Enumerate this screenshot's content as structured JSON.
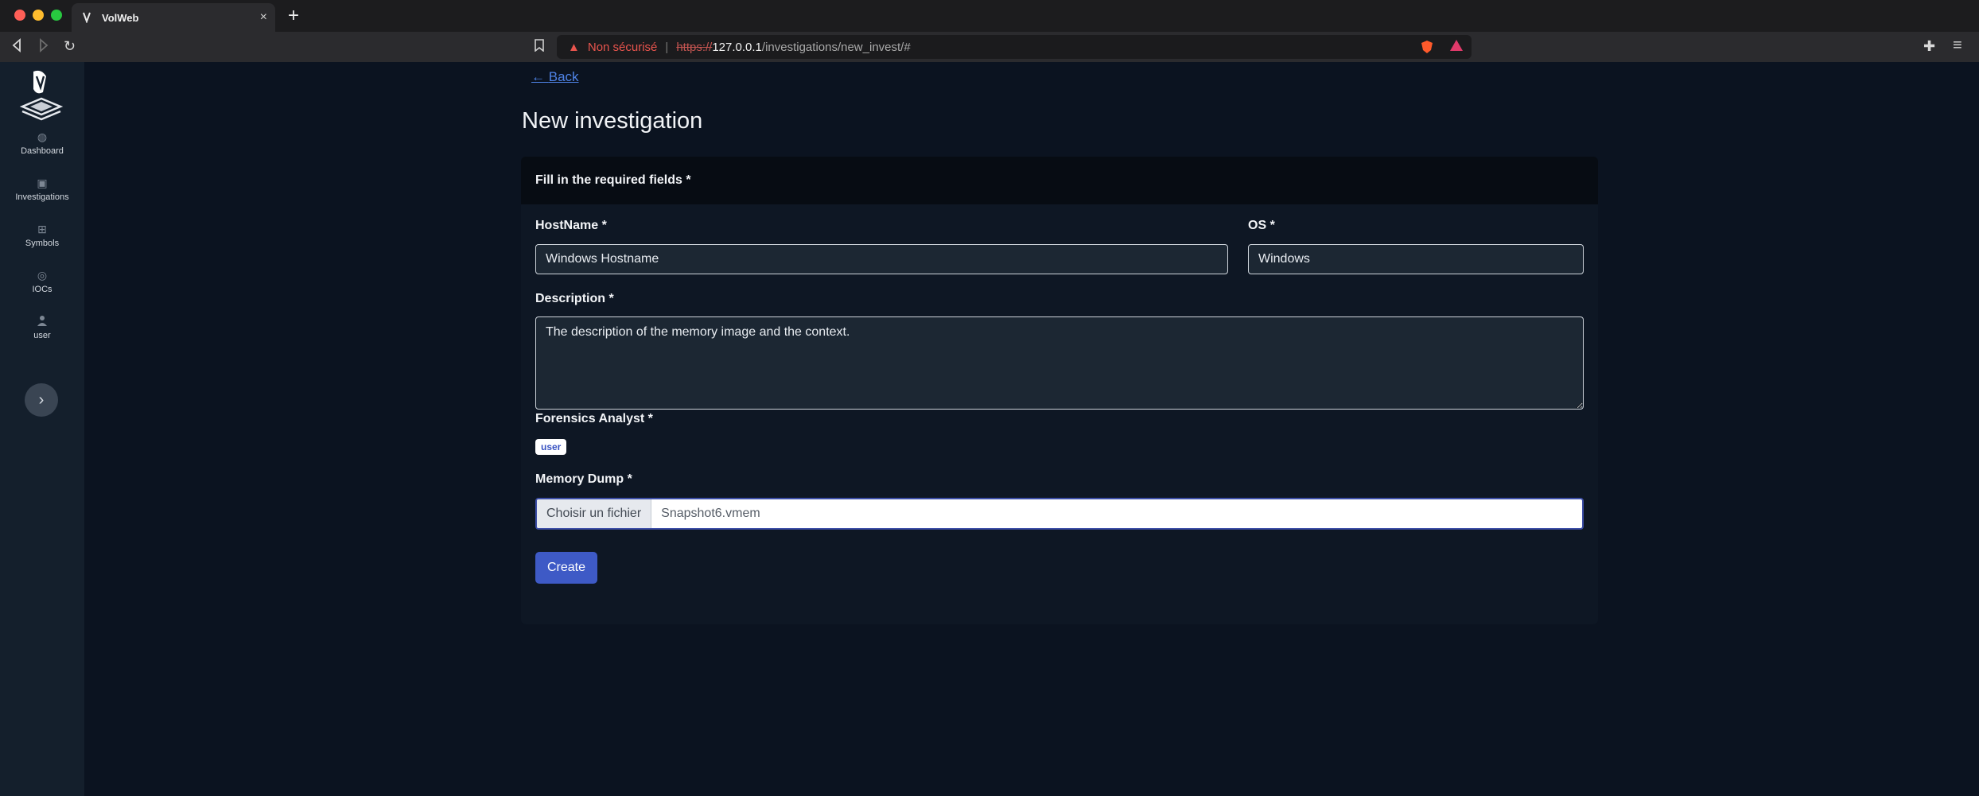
{
  "browser": {
    "tab_title": "VolWeb",
    "new_tab": "+",
    "url": {
      "insecure_label": "Non sécurisé",
      "separator": "|",
      "scheme": "https://",
      "host": "127.0.0.1",
      "path": "/investigations/new_invest/#"
    },
    "icons": {
      "close": "close-icon",
      "back": "back-arrow-icon",
      "forward": "forward-arrow-icon",
      "reload": "reload-icon",
      "bookmark": "bookmark-icon",
      "warning": "warning-icon",
      "brave": "brave-shield-icon",
      "rewards": "rewards-icon",
      "extensions": "puzzle-icon",
      "menu": "hamburger-icon"
    }
  },
  "sidebar": {
    "items": [
      {
        "label": "Dashboard",
        "icon": "dashboard-icon"
      },
      {
        "label": "Investigations",
        "icon": "briefcase-icon"
      },
      {
        "label": "Symbols",
        "icon": "table-icon"
      },
      {
        "label": "IOCs",
        "icon": "target-icon"
      },
      {
        "label": "user",
        "icon": "user-icon"
      }
    ],
    "expand_icon": "chevron-right-icon"
  },
  "main": {
    "back_label": "Back",
    "title": "New investigation",
    "card_header": "Fill in the required fields *",
    "hostname": {
      "label": "HostName *",
      "value": "Windows Hostname"
    },
    "os": {
      "label": "OS *",
      "value": "Windows"
    },
    "description": {
      "label": "Description *",
      "value": "The description of the memory image and the context."
    },
    "analyst": {
      "label": "Forensics Analyst  *",
      "badge": "user"
    },
    "memory_dump": {
      "label": "Memory Dump *",
      "button": "Choisir un fichier",
      "filename": "Snapshot6.vmem"
    },
    "create_label": "Create"
  },
  "colors": {
    "page_bg": "#0b1320",
    "card_bg": "#0e1724",
    "accent": "#3e5ac6",
    "link": "#4f83e6",
    "insecure": "#e8544d"
  }
}
